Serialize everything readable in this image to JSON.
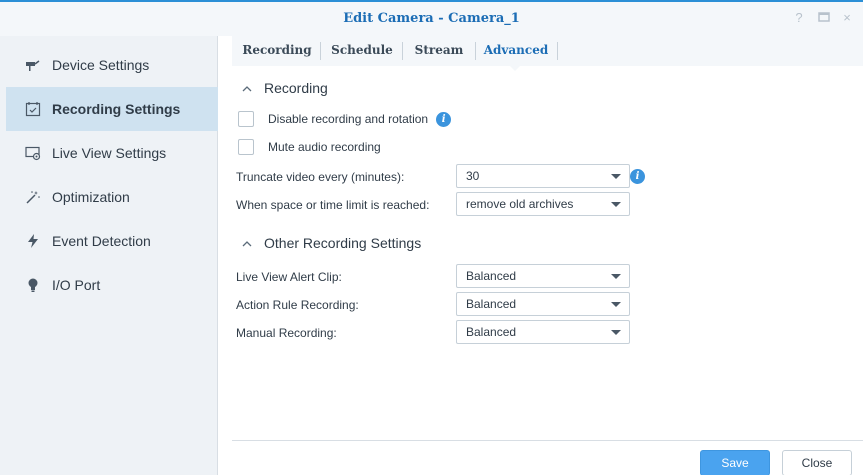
{
  "window": {
    "title": "Edit Camera - Camera_1",
    "controls": {
      "help": "?",
      "maximize": "▭",
      "close": "×"
    }
  },
  "sidebar": {
    "items": [
      {
        "label": "Device Settings",
        "icon": "camera-icon",
        "active": false
      },
      {
        "label": "Recording Settings",
        "icon": "calendar-icon",
        "active": true
      },
      {
        "label": "Live View Settings",
        "icon": "live-view-icon",
        "active": false
      },
      {
        "label": "Optimization",
        "icon": "magic-wand-icon",
        "active": false
      },
      {
        "label": "Event Detection",
        "icon": "lightning-icon",
        "active": false
      },
      {
        "label": "I/O Port",
        "icon": "bulb-icon",
        "active": false
      }
    ]
  },
  "tabs": [
    {
      "label": "Recording",
      "active": false
    },
    {
      "label": "Schedule",
      "active": false
    },
    {
      "label": "Stream",
      "active": false
    },
    {
      "label": "Advanced",
      "active": true
    }
  ],
  "recording_section": {
    "title": "Recording",
    "disable_rotation_label": "Disable recording and rotation",
    "mute_audio_label": "Mute audio recording",
    "truncate_label": "Truncate video every (minutes):",
    "truncate_value": "30",
    "limit_label": "When space or time limit is reached:",
    "limit_value": "remove old archives"
  },
  "other_section": {
    "title": "Other Recording Settings",
    "live_view_label": "Live View Alert Clip:",
    "live_view_value": "Balanced",
    "action_rule_label": "Action Rule Recording:",
    "action_rule_value": "Balanced",
    "manual_label": "Manual Recording:",
    "manual_value": "Balanced"
  },
  "footer": {
    "save_label": "Save",
    "close_label": "Close"
  },
  "colors": {
    "accent": "#1c6db5",
    "save_button": "#4aa3ef",
    "sidebar_active": "#cfe2f0",
    "info_icon": "#3b94dd"
  }
}
